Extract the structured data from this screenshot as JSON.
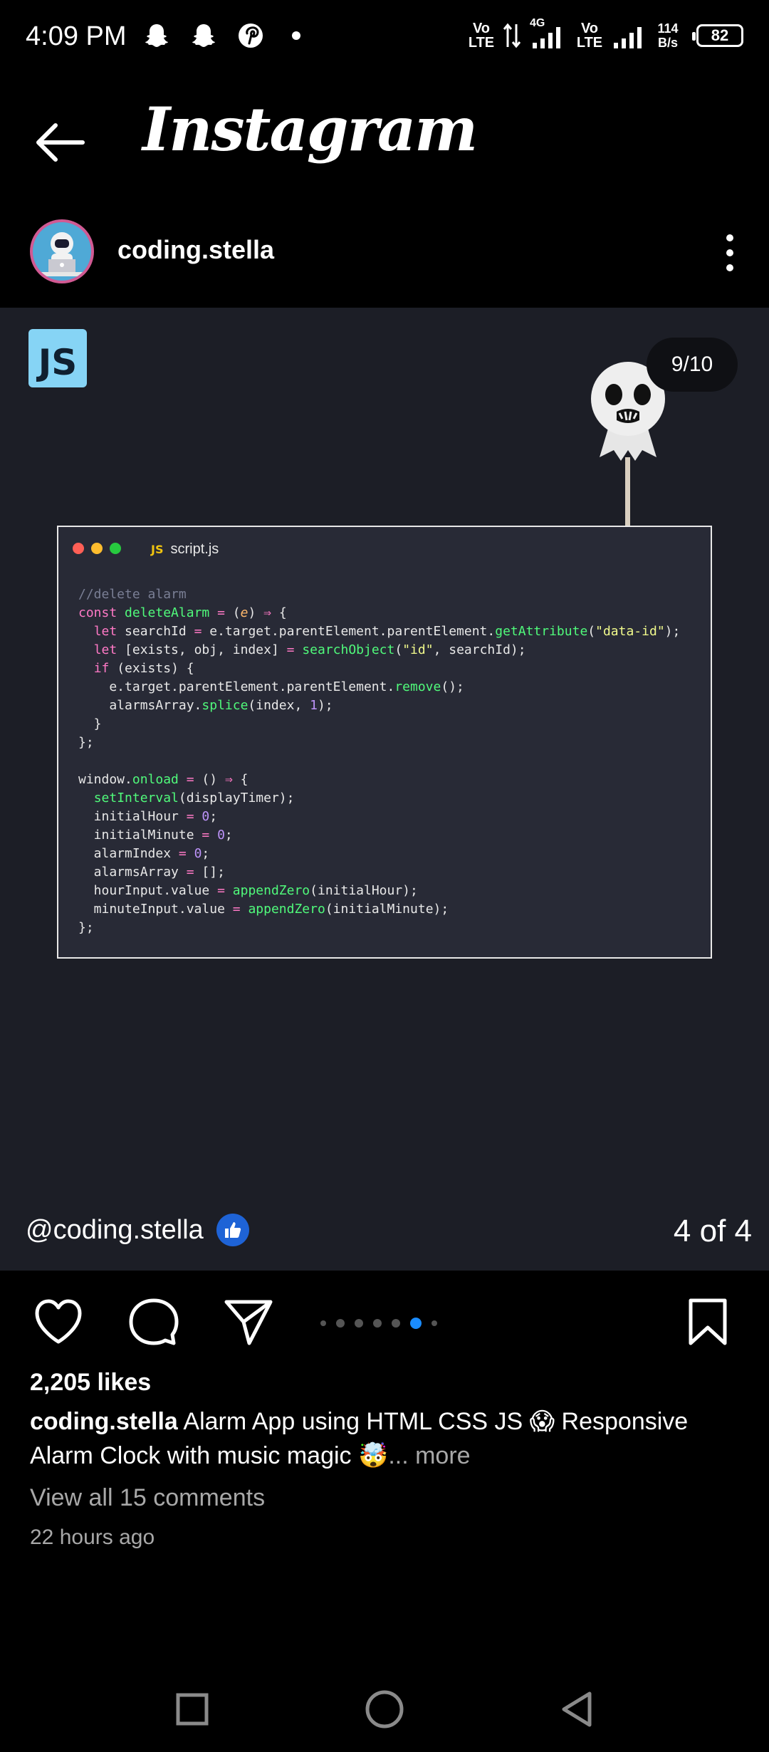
{
  "status_bar": {
    "time": "4:09 PM",
    "notification_icons": [
      "snapchat-icon",
      "snapchat-icon",
      "pinterest-icon"
    ],
    "volte1": "Vo LTE",
    "network": "4G",
    "volte2": "Vo LTE",
    "net_speed_value": "114",
    "net_speed_unit": "B/s",
    "battery": "82"
  },
  "app_bar": {
    "title": "Instagram"
  },
  "post_header": {
    "username": "coding.stella"
  },
  "post": {
    "badge": "JS",
    "slide_counter": "9/10",
    "file_name": "script.js",
    "file_lang": "JS",
    "credit": "@coding.stella",
    "page_indicator": "4 of 4",
    "colors": {
      "window_red": "#ff5f56",
      "window_yellow": "#ffbd2e",
      "window_green": "#27c93f",
      "background": "#1c1e26",
      "code_bg": "#282a36"
    }
  },
  "engagement": {
    "likes": "2,205 likes",
    "caption_user": "coding.stella",
    "caption_text": " Alarm App using HTML CSS JS 😱 Responsive Alarm Clock with music magic 🤯",
    "more": "... more",
    "view_comments": "View all 15 comments",
    "time_ago": "22 hours ago",
    "carousel_active_index": 5,
    "carousel_count": 7
  },
  "nav_bar": {
    "buttons": [
      "recents-button",
      "home-button",
      "back-button"
    ]
  }
}
